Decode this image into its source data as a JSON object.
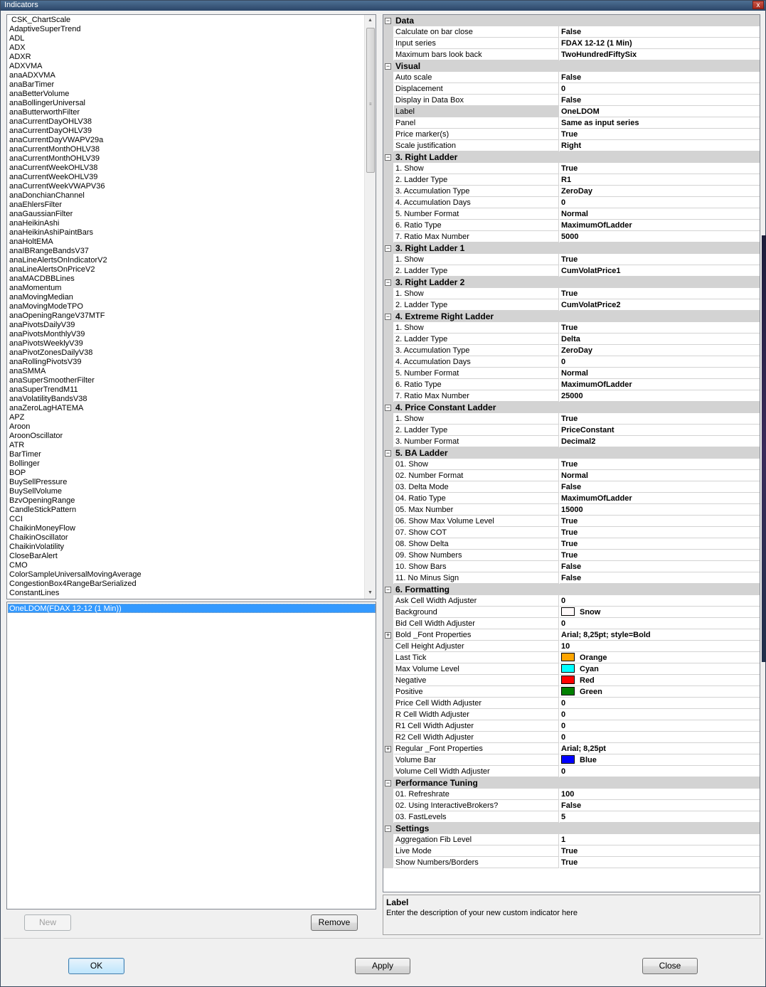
{
  "window": {
    "title": "Indicators",
    "close_glyph": "x"
  },
  "indicator_list": [
    "CSK_ChartScale",
    "AdaptiveSuperTrend",
    "ADL",
    "ADX",
    "ADXR",
    "ADXVMA",
    "anaADXVMA",
    "anaBarTimer",
    "anaBetterVolume",
    "anaBollingerUniversal",
    "anaButterworthFilter",
    "anaCurrentDayOHLV38",
    "anaCurrentDayOHLV39",
    "anaCurrentDayVWAPV29a",
    "anaCurrentMonthOHLV38",
    "anaCurrentMonthOHLV39",
    "anaCurrentWeekOHLV38",
    "anaCurrentWeekOHLV39",
    "anaCurrentWeekVWAPV36",
    "anaDonchianChannel",
    "anaEhlersFilter",
    "anaGaussianFilter",
    "anaHeikinAshi",
    "anaHeikinAshiPaintBars",
    "anaHoltEMA",
    "anaIBRangeBandsV37",
    "anaLineAlertsOnIndicatorV2",
    "anaLineAlertsOnPriceV2",
    "anaMACDBBLines",
    "anaMomentum",
    "anaMovingMedian",
    "anaMovingModeTPO",
    "anaOpeningRangeV37MTF",
    "anaPivotsDailyV39",
    "anaPivotsMonthlyV39",
    "anaPivotsWeeklyV39",
    "anaPivotZonesDailyV38",
    "anaRollingPivotsV39",
    "anaSMMA",
    "anaSuperSmootherFilter",
    "anaSuperTrendM11",
    "anaVolatilityBandsV38",
    "anaZeroLagHATEMA",
    "APZ",
    "Aroon",
    "AroonOscillator",
    "ATR",
    "BarTimer",
    "Bollinger",
    "BOP",
    "BuySellPressure",
    "BuySellVolume",
    "BzvOpeningRange",
    "CandleStickPattern",
    "CCI",
    "ChaikinMoneyFlow",
    "ChaikinOscillator",
    "ChaikinVolatility",
    "CloseBarAlert",
    "CMO",
    "ColorSampleUniversalMovingAverage",
    "CongestionBox4RangeBarSerialized",
    "ConstantLines"
  ],
  "scroll": {
    "up": "▲",
    "down": "▼",
    "grip": "≡"
  },
  "selected_indicators": [
    "OneLDOM(FDAX 12-12 (1 Min))"
  ],
  "buttons": {
    "new": "New",
    "remove": "Remove",
    "ok": "OK",
    "apply": "Apply",
    "close": "Close"
  },
  "toggle_glyphs": {
    "collapse": "−",
    "expand": "+"
  },
  "properties": [
    {
      "category": "Data",
      "items": [
        {
          "name": "Calculate on bar close",
          "value": "False"
        },
        {
          "name": "Input series",
          "value": "FDAX 12-12 (1 Min)"
        },
        {
          "name": "Maximum bars look back",
          "value": "TwoHundredFiftySix"
        }
      ]
    },
    {
      "category": "Visual",
      "items": [
        {
          "name": "Auto scale",
          "value": "False"
        },
        {
          "name": "Displacement",
          "value": "0"
        },
        {
          "name": "Display in Data Box",
          "value": "False"
        },
        {
          "name": "Label",
          "value": "OneLDOM",
          "selected": true
        },
        {
          "name": "Panel",
          "value": "Same as input series"
        },
        {
          "name": "Price marker(s)",
          "value": "True"
        },
        {
          "name": "Scale justification",
          "value": "Right"
        }
      ]
    },
    {
      "category": "3. Right Ladder",
      "items": [
        {
          "name": "1. Show",
          "value": "True"
        },
        {
          "name": "2. Ladder Type",
          "value": "R1"
        },
        {
          "name": "3. Accumulation Type",
          "value": "ZeroDay"
        },
        {
          "name": "4. Accumulation Days",
          "value": "0"
        },
        {
          "name": "5. Number Format",
          "value": "Normal"
        },
        {
          "name": "6. Ratio Type",
          "value": "MaximumOfLadder"
        },
        {
          "name": "7. Ratio Max Number",
          "value": "5000"
        }
      ]
    },
    {
      "category": "3. Right Ladder 1",
      "items": [
        {
          "name": "1. Show",
          "value": "True"
        },
        {
          "name": "2. Ladder Type",
          "value": "CumVolatPrice1"
        }
      ]
    },
    {
      "category": "3. Right Ladder 2",
      "items": [
        {
          "name": "1. Show",
          "value": "True"
        },
        {
          "name": "2. Ladder Type",
          "value": "CumVolatPrice2"
        }
      ]
    },
    {
      "category": "4. Extreme Right Ladder",
      "items": [
        {
          "name": "1. Show",
          "value": "True"
        },
        {
          "name": "2. Ladder Type",
          "value": "Delta"
        },
        {
          "name": "3. Accumulation Type",
          "value": "ZeroDay"
        },
        {
          "name": "4. Accumulation Days",
          "value": "0"
        },
        {
          "name": "5. Number Format",
          "value": "Normal"
        },
        {
          "name": "6. Ratio Type",
          "value": "MaximumOfLadder"
        },
        {
          "name": "7. Ratio Max Number",
          "value": "25000"
        }
      ]
    },
    {
      "category": "4. Price Constant Ladder",
      "items": [
        {
          "name": "1. Show",
          "value": "True"
        },
        {
          "name": "2. Ladder Type",
          "value": "PriceConstant"
        },
        {
          "name": "3. Number Format",
          "value": "Decimal2"
        }
      ]
    },
    {
      "category": "5. BA Ladder",
      "items": [
        {
          "name": "01. Show",
          "value": "True"
        },
        {
          "name": "02. Number Format",
          "value": "Normal"
        },
        {
          "name": "03. Delta Mode",
          "value": "False"
        },
        {
          "name": "04. Ratio Type",
          "value": "MaximumOfLadder"
        },
        {
          "name": "05. Max Number",
          "value": "15000"
        },
        {
          "name": "06. Show Max Volume Level",
          "value": "True"
        },
        {
          "name": "07. Show COT",
          "value": "True"
        },
        {
          "name": "08. Show Delta",
          "value": "True"
        },
        {
          "name": "09. Show Numbers",
          "value": "True"
        },
        {
          "name": "10. Show Bars",
          "value": "False"
        },
        {
          "name": "11. No Minus Sign",
          "value": "False"
        }
      ]
    },
    {
      "category": "6. Formatting",
      "items": [
        {
          "name": "Ask Cell Width Adjuster",
          "value": "0"
        },
        {
          "name": "Background",
          "value": "Snow",
          "color": "#fffafa"
        },
        {
          "name": "Bid Cell Width Adjuster",
          "value": "0"
        },
        {
          "name": "Bold _Font Properties",
          "value": "Arial; 8,25pt; style=Bold",
          "expandable": true
        },
        {
          "name": "Cell Height Adjuster",
          "value": "10"
        },
        {
          "name": "Last Tick",
          "value": "Orange",
          "color": "#ffa500"
        },
        {
          "name": "Max Volume Level",
          "value": "Cyan",
          "color": "#00ffff"
        },
        {
          "name": "Negative",
          "value": "Red",
          "color": "#ff0000"
        },
        {
          "name": "Positive",
          "value": "Green",
          "color": "#008000"
        },
        {
          "name": "Price Cell Width Adjuster",
          "value": "0"
        },
        {
          "name": "R Cell Width Adjuster",
          "value": "0"
        },
        {
          "name": "R1 Cell Width Adjuster",
          "value": "0"
        },
        {
          "name": "R2 Cell Width Adjuster",
          "value": "0"
        },
        {
          "name": "Regular _Font Properties",
          "value": "Arial; 8,25pt",
          "expandable": true
        },
        {
          "name": "Volume Bar",
          "value": "Blue",
          "color": "#0000ff"
        },
        {
          "name": "Volume Cell Width Adjuster",
          "value": "0"
        }
      ]
    },
    {
      "category": "Performance Tuning",
      "items": [
        {
          "name": "01. Refreshrate",
          "value": "100"
        },
        {
          "name": "02. Using InteractiveBrokers?",
          "value": "False"
        },
        {
          "name": "03. FastLevels",
          "value": "5"
        }
      ]
    },
    {
      "category": "Settings",
      "items": [
        {
          "name": "Aggregation Fib Level",
          "value": "1"
        },
        {
          "name": "Live Mode",
          "value": "True"
        },
        {
          "name": "Show Numbers/Borders",
          "value": "True"
        }
      ]
    }
  ],
  "description": {
    "title": "Label",
    "text": "Enter the description of your new custom indicator here"
  }
}
